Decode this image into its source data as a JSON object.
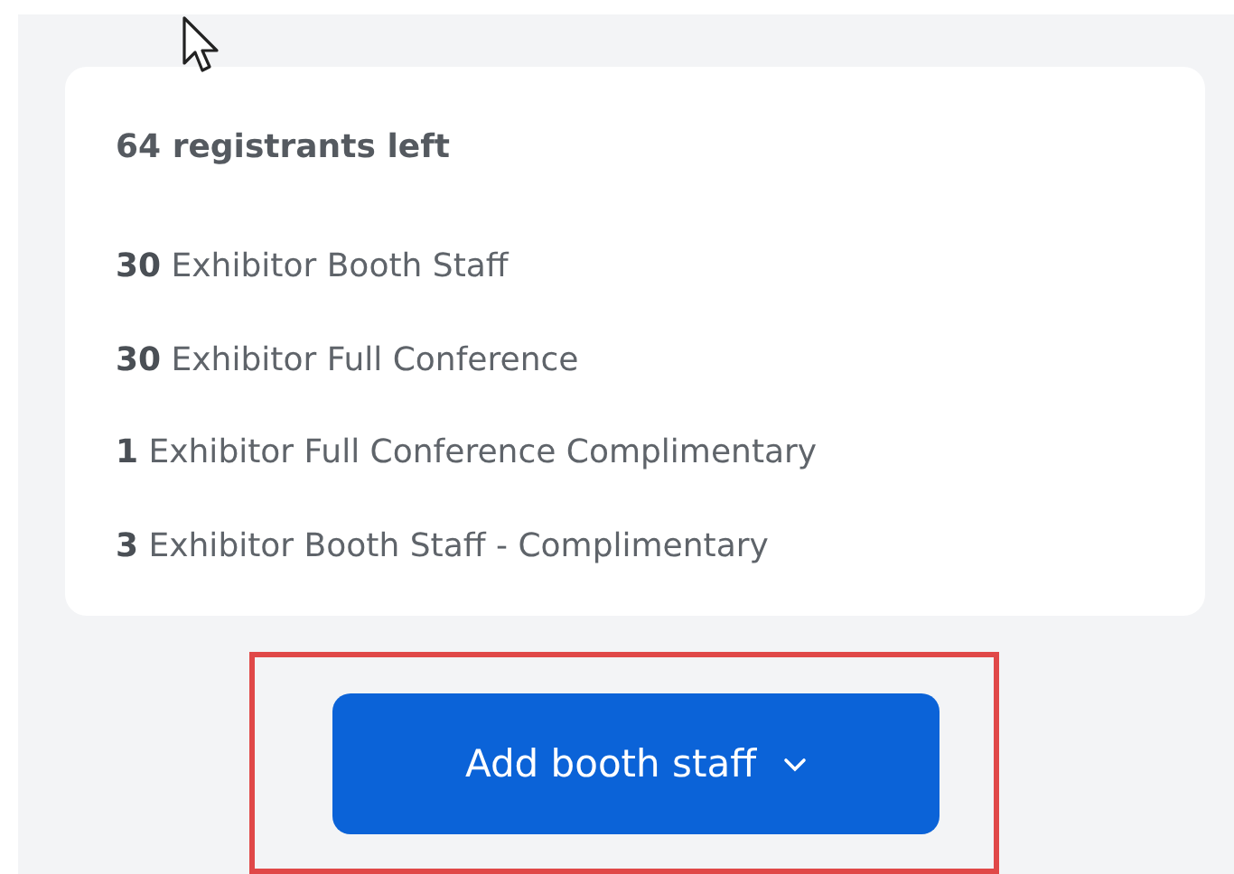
{
  "summary": {
    "title": "64 registrants left",
    "items": [
      "**30** Exhibitor Booth Staff",
      "**30** Exhibitor Full Conference",
      "**1** Exhibitor Full Conference Complimentary",
      "**3** Exhibitor Booth Staff - Complimentary"
    ]
  },
  "button": {
    "label": "Add booth staff"
  }
}
